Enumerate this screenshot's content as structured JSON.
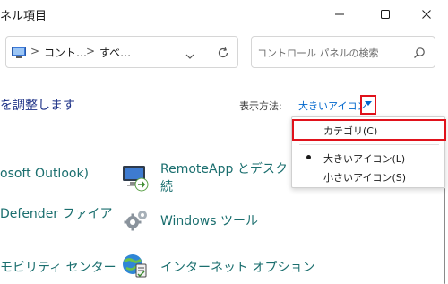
{
  "window": {
    "title": "ネル項目",
    "minimize_icon": "minimize-icon",
    "maximize_icon": "maximize-icon",
    "close_icon": "close-icon"
  },
  "address_bar": {
    "folder_icon": "control-panel-icon",
    "crumbs": [
      "コント…",
      "すべ…"
    ],
    "separator": ">",
    "dropdown_icon": "chevron-down-icon",
    "refresh_icon": "refresh-icon"
  },
  "search": {
    "placeholder": "コントロール パネルの検索",
    "icon": "search-icon"
  },
  "content": {
    "heading": "を調整します",
    "view_by_label": "表示方法:",
    "view_by_value": "大きいアイコン"
  },
  "view_menu": {
    "items": [
      {
        "label": "カテゴリ(C)",
        "selected": false,
        "highlighted": true
      },
      {
        "label": "大きいアイコン(L)",
        "selected": true,
        "highlighted": false
      },
      {
        "label": "小さいアイコン(S)",
        "selected": false,
        "highlighted": false
      }
    ]
  },
  "items_left": [
    {
      "label": "osoft Outlook)"
    },
    {
      "label": "Defender ファイア"
    },
    {
      "label": "モビリティ センター"
    }
  ],
  "items_right": [
    {
      "label_line1": "RemoteApp とデスクト",
      "label_line2": "続",
      "icon": "remoteapp-icon"
    },
    {
      "label": "Windows ツール",
      "icon": "gears-icon"
    },
    {
      "label": "インターネット オプション",
      "icon": "internet-options-icon"
    }
  ],
  "colors": {
    "link": "#1a6e6e",
    "heading": "#1e3287",
    "accent": "#0066cc",
    "highlight_border": "#e0121b"
  }
}
